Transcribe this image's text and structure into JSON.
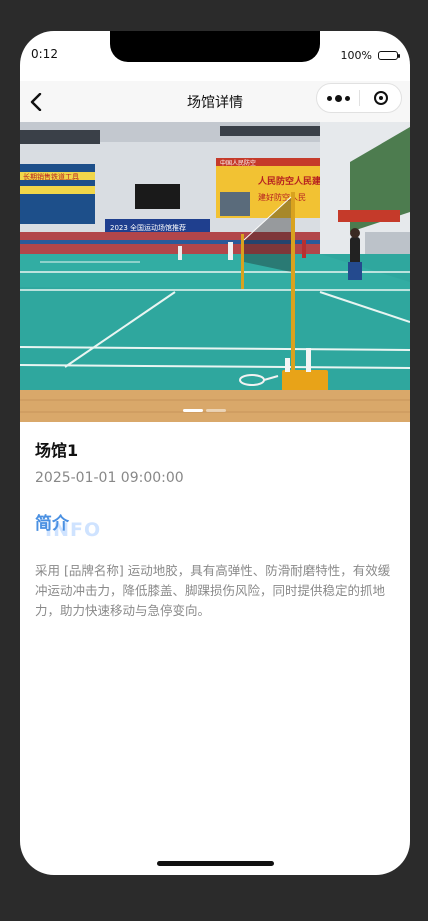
{
  "status": {
    "time": "0:12",
    "battery": "100%"
  },
  "navbar": {
    "title": "场馆详情"
  },
  "venue": {
    "name": "场馆1",
    "datetime": "2025-01-01 09:00:00",
    "section_title": "简介",
    "section_bg": "INFO",
    "intro": "采用 [品牌名称] 运动地胶，具有高弹性、防滑耐磨特性，有效缓冲运动冲击力，降低膝盖、脚踝损伤风险，同时提供稳定的抓地力，助力快速移动与急停变向。"
  },
  "hero": {
    "banners": [
      "人民防空人民建",
      "建好防空人民",
      "2023 全国运动场馆推荐",
      "中国人民防空",
      "长期销售铁道工具"
    ]
  },
  "colors": {
    "accent": "#4a90e2",
    "court": "#2fa79e",
    "floor": "#d9a86a"
  }
}
